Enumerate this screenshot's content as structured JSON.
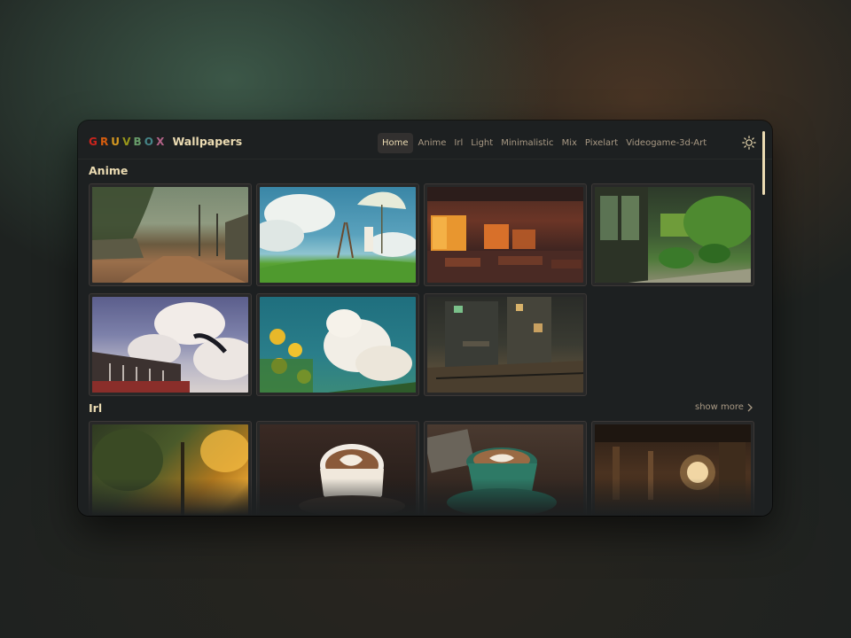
{
  "brand": {
    "word": [
      {
        "ch": "G",
        "color": "#cc241d"
      },
      {
        "ch": "R",
        "color": "#d65d0e"
      },
      {
        "ch": "U",
        "color": "#d79921"
      },
      {
        "ch": "V",
        "color": "#98971a"
      },
      {
        "ch": "B",
        "color": "#689d6a"
      },
      {
        "ch": "O",
        "color": "#458588"
      },
      {
        "ch": "X",
        "color": "#b16286"
      }
    ],
    "title": "Wallpapers"
  },
  "nav": {
    "items": [
      {
        "label": "Home",
        "active": true
      },
      {
        "label": "Anime",
        "active": false
      },
      {
        "label": "Irl",
        "active": false
      },
      {
        "label": "Light",
        "active": false
      },
      {
        "label": "Minimalistic",
        "active": false
      },
      {
        "label": "Mix",
        "active": false
      },
      {
        "label": "Pixelart",
        "active": false
      },
      {
        "label": "Videogame-3d-Art",
        "active": false
      }
    ],
    "theme_icon": "sun-icon"
  },
  "sections": [
    {
      "title": "Anime"
    },
    {
      "title": "Irl",
      "show_more": "show more"
    }
  ],
  "colors": {
    "bg": "#1d2021",
    "card": "#282828",
    "text": "#ebdbb2",
    "muted": "#a89984",
    "active_tab": "#32302f"
  }
}
